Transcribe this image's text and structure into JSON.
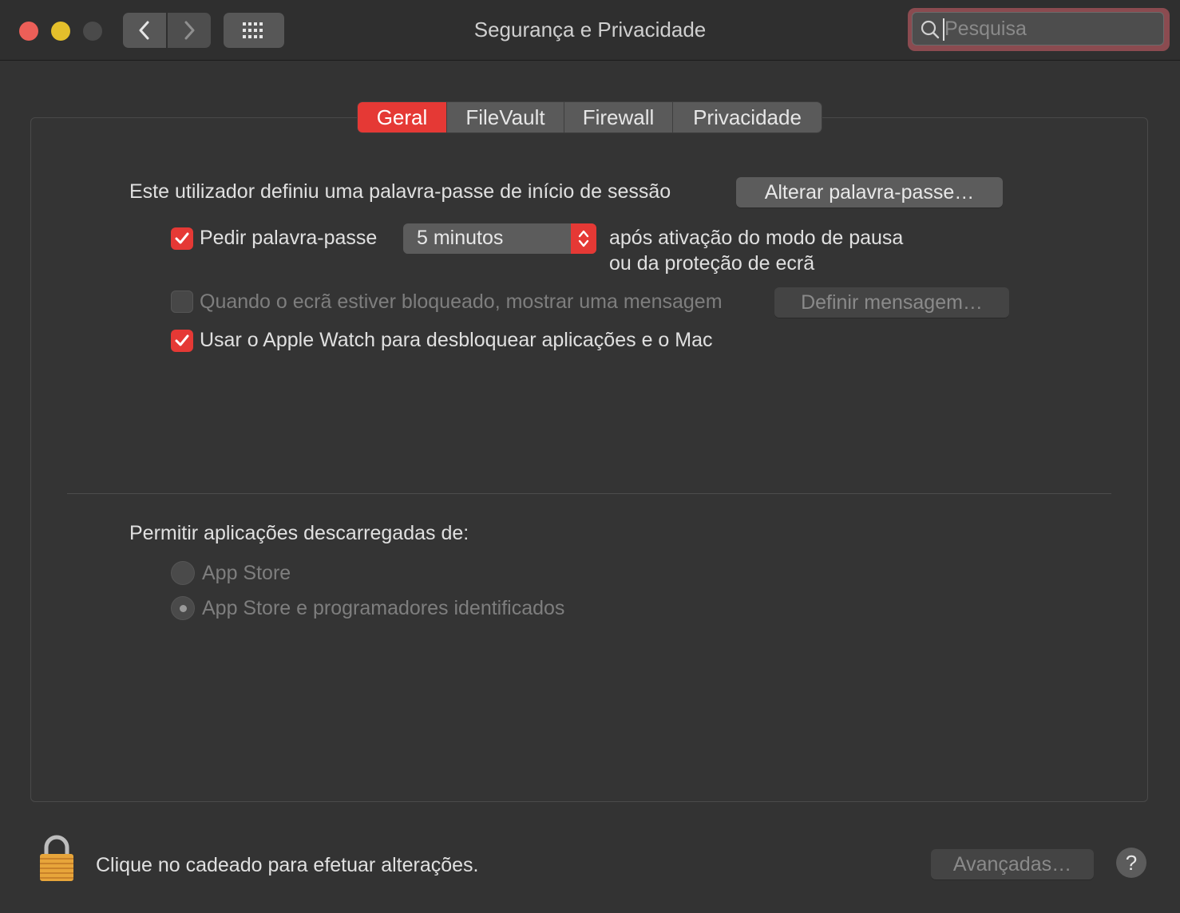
{
  "window": {
    "title": "Segurança e Privacidade"
  },
  "search": {
    "placeholder": "Pesquisa",
    "value": ""
  },
  "tabs": [
    {
      "label": "Geral",
      "active": true
    },
    {
      "label": "FileVault",
      "active": false
    },
    {
      "label": "Firewall",
      "active": false
    },
    {
      "label": "Privacidade",
      "active": false
    }
  ],
  "general": {
    "password_set_text": "Este utilizador definiu uma palavra-passe de início de sessão",
    "change_password_button": "Alterar palavra-passe…",
    "require_password": {
      "label": "Pedir palavra-passe",
      "checked": true,
      "delay_value": "5 minutos",
      "suffix_line1": "após ativação do modo de pausa",
      "suffix_line2": "ou da proteção de ecrã"
    },
    "lock_message": {
      "label": "Quando o ecrã estiver bloqueado, mostrar uma mensagem",
      "checked": false,
      "enabled": false,
      "button": "Definir mensagem…"
    },
    "apple_watch": {
      "label": "Usar o Apple Watch para desbloquear aplicações e o Mac",
      "checked": true
    }
  },
  "downloads": {
    "heading": "Permitir aplicações descarregadas de:",
    "options": [
      {
        "label": "App Store",
        "selected": false
      },
      {
        "label": "App Store e programadores identificados",
        "selected": true
      }
    ]
  },
  "footer": {
    "lock_text": "Clique no cadeado para efetuar alterações.",
    "advanced_button": "Avançadas…",
    "help_label": "?"
  },
  "colors": {
    "accent": "#e53935",
    "background": "#333333",
    "close": "#ec5f58",
    "minimize": "#e4bf2b"
  }
}
